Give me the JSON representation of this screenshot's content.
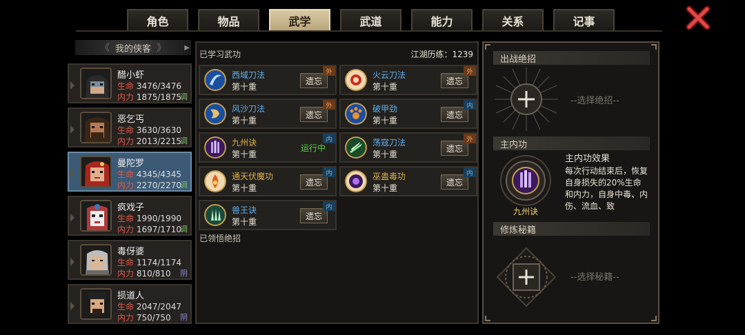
{
  "tabs": [
    {
      "label": "角色",
      "active": false
    },
    {
      "label": "物品",
      "active": false
    },
    {
      "label": "武学",
      "active": true
    },
    {
      "label": "武道",
      "active": false
    },
    {
      "label": "能力",
      "active": false
    },
    {
      "label": "关系",
      "active": false
    },
    {
      "label": "记事",
      "active": false
    }
  ],
  "roster": {
    "header": "我的侠客",
    "characters": [
      {
        "name": "醋小虾",
        "hp_label": "生命",
        "hp": "3476/3476",
        "mp_label": "内力",
        "mp": "1875/1875",
        "tag": "调",
        "selected": false
      },
      {
        "name": "恶乞丐",
        "hp_label": "生命",
        "hp": "3630/3630",
        "mp_label": "内力",
        "mp": "2013/2215",
        "tag": "调",
        "selected": false
      },
      {
        "name": "曼陀罗",
        "hp_label": "生命",
        "hp": "4345/4345",
        "mp_label": "内力",
        "mp": "2270/2270",
        "tag": "调",
        "selected": true
      },
      {
        "name": "疯戏子",
        "hp_label": "生命",
        "hp": "1990/1990",
        "mp_label": "内力",
        "mp": "1697/1710",
        "tag": "调",
        "selected": false
      },
      {
        "name": "毒伢婆",
        "hp_label": "生命",
        "hp": "1174/1174",
        "mp_label": "内力",
        "mp": "810/810",
        "tag": "阴",
        "selected": false
      },
      {
        "name": "损道人",
        "hp_label": "生命",
        "hp": "2047/2047",
        "mp_label": "内力",
        "mp": "750/750",
        "tag": "阴",
        "selected": false
      }
    ]
  },
  "skills_panel": {
    "title": "已学习武功",
    "experience": "江湖历练：1239",
    "learned_title": "已领悟绝招",
    "forget_label": "遗忘",
    "running_label": "运行中",
    "skills": [
      {
        "name": "西域刀法",
        "level": "第十重",
        "type": "外",
        "color": "blue",
        "running": false,
        "icon": "blade-swirl-icon"
      },
      {
        "name": "火云刀法",
        "level": "第十重",
        "type": "外",
        "color": "blue",
        "running": false,
        "icon": "fire-cloud-icon"
      },
      {
        "name": "风沙刀法",
        "level": "第十重",
        "type": "外",
        "color": "blue",
        "running": false,
        "icon": "wind-sand-icon"
      },
      {
        "name": "破甲劲",
        "level": "第十重",
        "type": "内",
        "color": "blue",
        "running": false,
        "icon": "paw-icon"
      },
      {
        "name": "九州诀",
        "level": "第十重",
        "type": "内",
        "color": "orange",
        "running": true,
        "icon": "purple-pillar-icon"
      },
      {
        "name": "荡寇刀法",
        "level": "第十重",
        "type": "外",
        "color": "blue",
        "running": false,
        "icon": "green-slash-icon"
      },
      {
        "name": "通天伏魔功",
        "level": "第十重",
        "type": "内",
        "color": "orange",
        "running": false,
        "icon": "flame-orb-icon"
      },
      {
        "name": "巫蛊毒功",
        "level": "第十重",
        "type": "内",
        "color": "orange",
        "running": false,
        "icon": "poison-orb-icon"
      },
      {
        "name": "兽王诀",
        "level": "第十重",
        "type": "内",
        "color": "blue",
        "running": false,
        "icon": "beast-claw-icon"
      }
    ]
  },
  "right_panel": {
    "ultimate_title": "出战绝招",
    "ultimate_hint": "--选择绝招--",
    "main_skill_title": "主内功",
    "main_skill_name": "九州诀",
    "effect_title": "主内功效果",
    "effect_text": "每次行动结束后，恢复自身损失的20%生命和内力，自身中毒、内伤、流血、致",
    "cultivation_title": "修炼秘籍",
    "cultivation_hint": "--选择秘籍--"
  },
  "colors": {
    "accent_gold": "#e8d070",
    "running_green": "#5bd24a",
    "hp_red": "#e05a4a",
    "selected_blue": "#3c5a75"
  }
}
